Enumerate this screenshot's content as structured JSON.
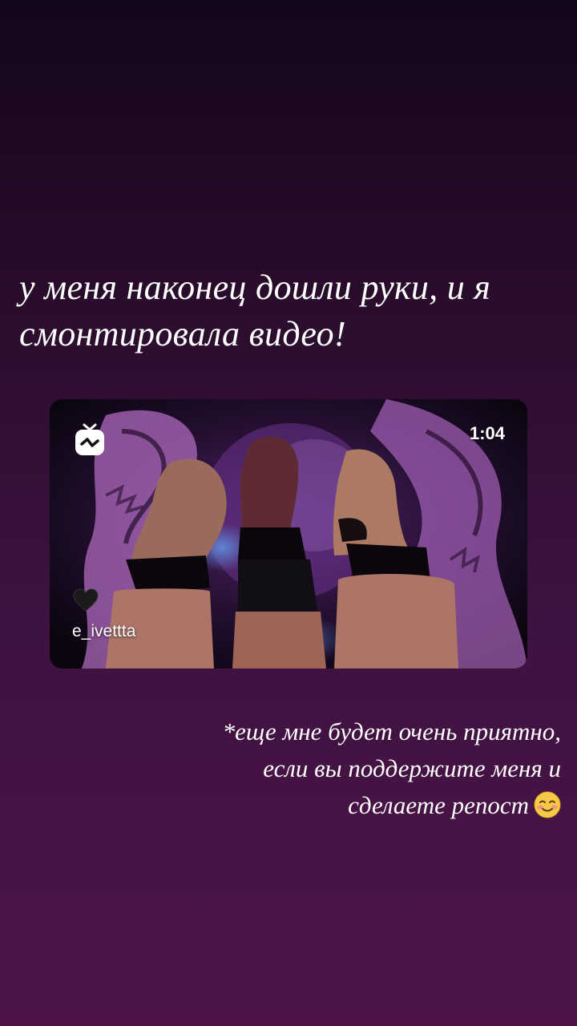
{
  "story": {
    "headline": "у меня наконец дошли руки, и я смонтировала видео!",
    "footnote_lines": [
      "*еще мне будет очень приятно,",
      "если вы поддержите меня и",
      "сделаете репост"
    ],
    "emoji": "smiling-face-icon"
  },
  "video": {
    "duration": "1:04",
    "username": "e_ivettta",
    "badge_icon": "igtv-icon",
    "heart_icon": "black-heart-icon"
  },
  "colors": {
    "background_top": "#14061a",
    "background_bottom": "#4e1448",
    "accent_purple": "#c06ad8"
  }
}
